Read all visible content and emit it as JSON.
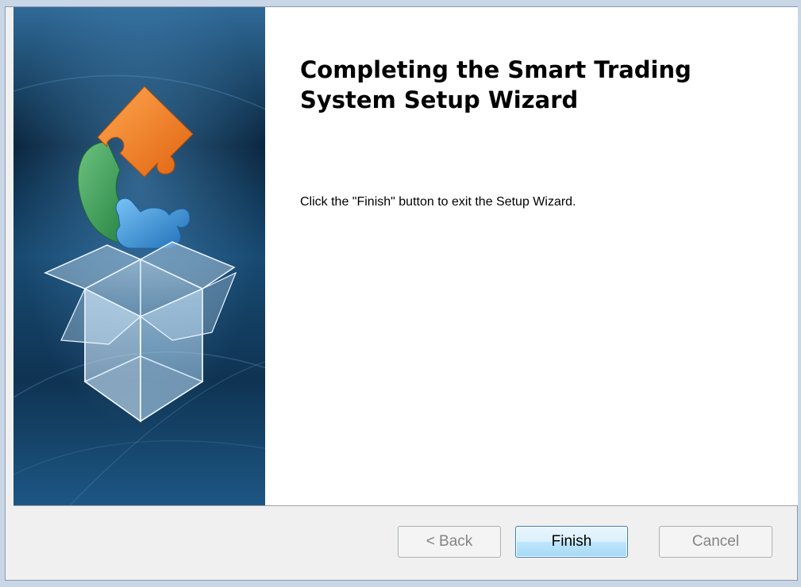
{
  "wizard": {
    "title": "Completing the Smart Trading System Setup Wizard",
    "instruction": "Click the \"Finish\" button to exit the Setup Wizard."
  },
  "buttons": {
    "back_label": "< Back",
    "finish_label": "Finish",
    "cancel_label": "Cancel",
    "back_enabled": false,
    "finish_enabled": true,
    "cancel_enabled": false
  },
  "banner": {
    "image": "puzzle-pieces-over-open-box",
    "colors": {
      "background_dark": "#0c2a45",
      "background_light": "#3d7aa8",
      "orange_piece": "#f07b1f",
      "green_piece": "#3aa05a",
      "blue_piece": "#3b8fd6"
    }
  },
  "colors": {
    "window_bg": "#f0f0f0",
    "content_bg": "#ffffff",
    "finish_border": "#3c7fb1",
    "disabled_text": "#838383"
  }
}
